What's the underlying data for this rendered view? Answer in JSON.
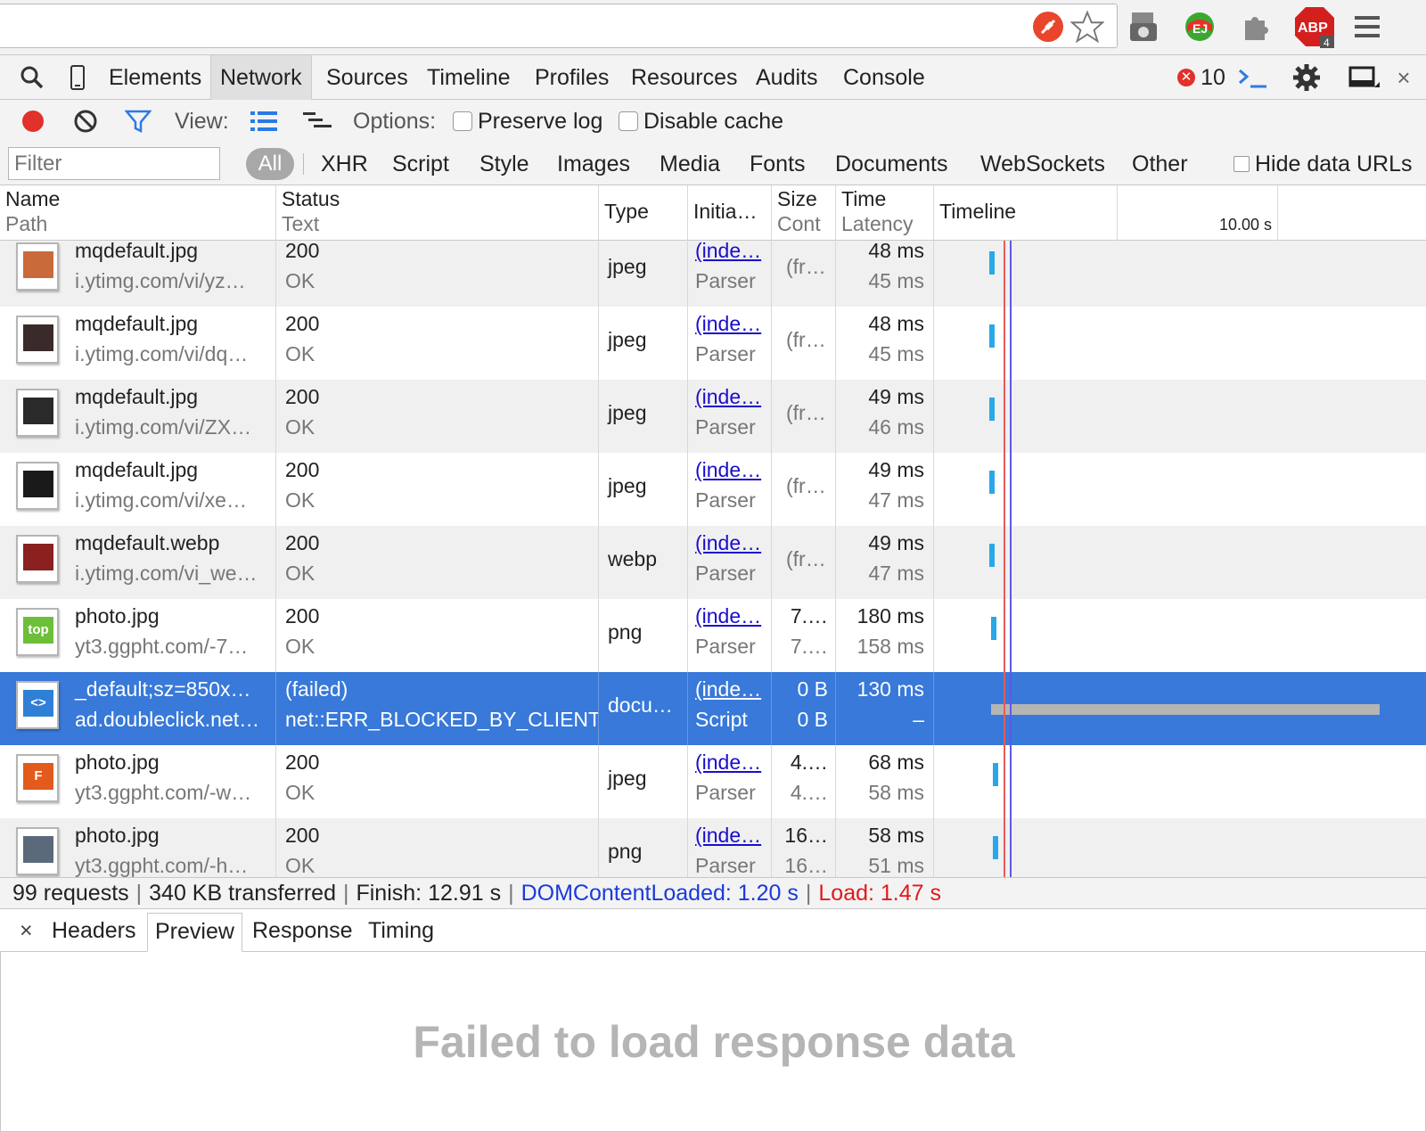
{
  "browser": {
    "extensions": [
      "blocked-plugin-icon",
      "star-icon",
      "camera-extension-icon",
      "colorful-extension-icon",
      "puzzle-piece-icon",
      "adblock-plus-icon",
      "menu-icon"
    ],
    "abp_label": "ABP",
    "abp_badge": "4"
  },
  "devtools": {
    "tabs": [
      "Elements",
      "Network",
      "Sources",
      "Timeline",
      "Profiles",
      "Resources",
      "Audits",
      "Console"
    ],
    "active_tab": "Network",
    "error_count": "10"
  },
  "network": {
    "view_label": "View:",
    "options_label": "Options:",
    "preserve_log": "Preserve log",
    "disable_cache": "Disable cache",
    "filter_placeholder": "Filter",
    "types": [
      "All",
      "XHR",
      "Script",
      "Style",
      "Images",
      "Media",
      "Fonts",
      "Documents",
      "WebSockets",
      "Other"
    ],
    "hide_data_urls": "Hide data URLs",
    "columns": {
      "name": "Name",
      "path": "Path",
      "status": "Status",
      "text": "Text",
      "type": "Type",
      "initiator": "Initia…",
      "size": "Size",
      "content": "Cont",
      "time": "Time",
      "latency": "Latency",
      "timeline": "Timeline"
    },
    "timeline_tick": "10.00 s",
    "rows": [
      {
        "name": "mqdefault.jpg",
        "path": "i.ytimg.com/vi/yz…",
        "status": "200",
        "text": "OK",
        "type": "jpeg",
        "initiator": "(inde…",
        "init_type": "Parser",
        "size": "(fr…",
        "content": "",
        "time": "48 ms",
        "latency": "45 ms",
        "thumb": "#c86a3a"
      },
      {
        "name": "mqdefault.jpg",
        "path": "i.ytimg.com/vi/dq…",
        "status": "200",
        "text": "OK",
        "type": "jpeg",
        "initiator": "(inde…",
        "init_type": "Parser",
        "size": "(fr…",
        "content": "",
        "time": "48 ms",
        "latency": "45 ms",
        "thumb": "#3a2a2a"
      },
      {
        "name": "mqdefault.jpg",
        "path": "i.ytimg.com/vi/ZX…",
        "status": "200",
        "text": "OK",
        "type": "jpeg",
        "initiator": "(inde…",
        "init_type": "Parser",
        "size": "(fr…",
        "content": "",
        "time": "49 ms",
        "latency": "46 ms",
        "thumb": "#2a2a2a"
      },
      {
        "name": "mqdefault.jpg",
        "path": "i.ytimg.com/vi/xe…",
        "status": "200",
        "text": "OK",
        "type": "jpeg",
        "initiator": "(inde…",
        "init_type": "Parser",
        "size": "(fr…",
        "content": "",
        "time": "49 ms",
        "latency": "47 ms",
        "thumb": "#1a1a1a"
      },
      {
        "name": "mqdefault.webp",
        "path": "i.ytimg.com/vi_we…",
        "status": "200",
        "text": "OK",
        "type": "webp",
        "initiator": "(inde…",
        "init_type": "Parser",
        "size": "(fr…",
        "content": "",
        "time": "49 ms",
        "latency": "47 ms",
        "thumb": "#8a2020"
      },
      {
        "name": "photo.jpg",
        "path": "yt3.ggpht.com/-7…",
        "status": "200",
        "text": "OK",
        "type": "png",
        "initiator": "(inde…",
        "init_type": "Parser",
        "size": "7.…",
        "content": "7.…",
        "time": "180 ms",
        "latency": "158 ms",
        "thumb": "#6dbf3a",
        "thumb_text": "top"
      },
      {
        "name": "_default;sz=850x…",
        "path": "ad.doubleclick.net…",
        "status": "(failed)",
        "text": "net::ERR_BLOCKED_BY_CLIENT",
        "type": "docu…",
        "initiator": "(inde…",
        "init_type": "Script",
        "size": "0 B",
        "content": "0 B",
        "time": "130 ms",
        "latency": "–",
        "thumb": "#2f7fd6",
        "thumb_text": "<>"
      },
      {
        "name": "photo.jpg",
        "path": "yt3.ggpht.com/-w…",
        "status": "200",
        "text": "OK",
        "type": "jpeg",
        "initiator": "(inde…",
        "init_type": "Parser",
        "size": "4.…",
        "content": "4.…",
        "time": "68 ms",
        "latency": "58 ms",
        "thumb": "#e25a1c",
        "thumb_text": "F"
      },
      {
        "name": "photo.jpg",
        "path": "yt3.ggpht.com/-h…",
        "status": "200",
        "text": "OK",
        "type": "png",
        "initiator": "(inde…",
        "init_type": "Parser",
        "size": "16…",
        "content": "16…",
        "time": "58 ms",
        "latency": "51 ms",
        "thumb": "#5a6a7a"
      }
    ],
    "summary": {
      "requests": "99 requests",
      "transferred": "340 KB transferred",
      "finish": "Finish: 12.91 s",
      "dcl": "DOMContentLoaded: 1.20 s",
      "load": "Load: 1.47 s"
    }
  },
  "details": {
    "close": "×",
    "tabs": [
      "Headers",
      "Preview",
      "Response",
      "Timing"
    ],
    "active_tab": "Preview",
    "message": "Failed to load response data"
  },
  "colors": {
    "selected_row": "#3879d9",
    "dcl": "#0000ff",
    "load": "#ff0000",
    "timing_bar": "#29a8e8"
  }
}
